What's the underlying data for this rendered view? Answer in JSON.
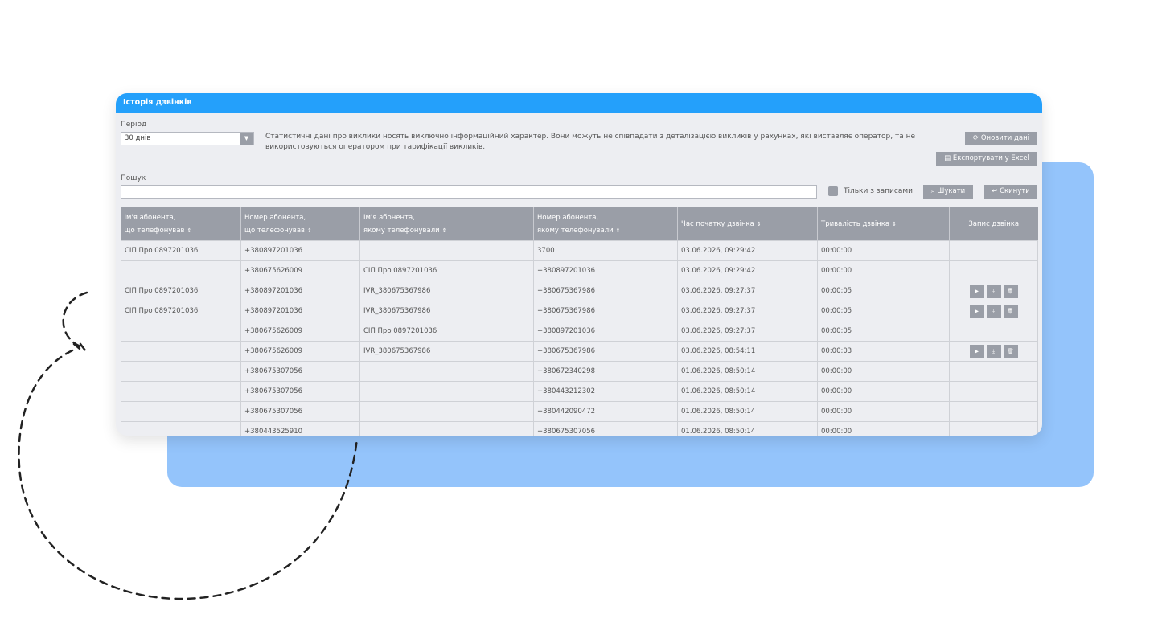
{
  "panel": {
    "title": "Історія дзвінків",
    "period_label": "Період",
    "period_value": "30 днів",
    "info_text": "Статистичні дані про виклики носять виключно інформаційний характер. Вони можуть не співпадати з деталізацією викликів у рахунках, які виставляє оператор, та не використовуються оператором при тарифікації викликів.",
    "refresh_label": "Оновити дані",
    "export_label": "Експортувати у Excel",
    "search_label": "Пошук",
    "search_value": "",
    "only_records_label": "Тільки з записами",
    "search_button": "Шукати",
    "reset_button": "Скинути"
  },
  "table": {
    "headers": [
      [
        "Ім'я абонента,",
        "що телефонував"
      ],
      [
        "Номер абонента,",
        "що телефонував"
      ],
      [
        "Ім'я абонента,",
        "якому телефонували"
      ],
      [
        "Номер абонента,",
        "якому телефонували"
      ],
      [
        "Час початку дзвінка",
        ""
      ],
      [
        "Тривалість дзвінка",
        ""
      ],
      [
        "Запис дзвінка",
        ""
      ]
    ],
    "rows": [
      [
        "СІП Про 0897201036",
        "+380897201036",
        "",
        "3700",
        "03.06.2026, 09:29:42",
        "00:00:00",
        false
      ],
      [
        "",
        "+380675626009",
        "СІП Про 0897201036",
        "+380897201036",
        "03.06.2026, 09:29:42",
        "00:00:00",
        false
      ],
      [
        "СІП Про 0897201036",
        "+380897201036",
        "IVR_380675367986",
        "+380675367986",
        "03.06.2026, 09:27:37",
        "00:00:05",
        true
      ],
      [
        "СІП Про 0897201036",
        "+380897201036",
        "IVR_380675367986",
        "+380675367986",
        "03.06.2026, 09:27:37",
        "00:00:05",
        true
      ],
      [
        "",
        "+380675626009",
        "СІП Про 0897201036",
        "+380897201036",
        "03.06.2026, 09:27:37",
        "00:00:05",
        false
      ],
      [
        "",
        "+380675626009",
        "IVR_380675367986",
        "+380675367986",
        "03.06.2026, 08:54:11",
        "00:00:03",
        true
      ],
      [
        "",
        "+380675307056",
        "",
        "+380672340298",
        "01.06.2026, 08:50:14",
        "00:00:00",
        false
      ],
      [
        "",
        "+380675307056",
        "",
        "+380443212302",
        "01.06.2026, 08:50:14",
        "00:00:00",
        false
      ],
      [
        "",
        "+380675307056",
        "",
        "+380442090472",
        "01.06.2026, 08:50:14",
        "00:00:00",
        false
      ],
      [
        "",
        "+380443525910",
        "",
        "+380675307056",
        "01.06.2026, 08:50:14",
        "00:00:00",
        false
      ]
    ]
  },
  "icons": {
    "refresh": "refresh-icon",
    "export": "export-icon",
    "search": "search-icon",
    "reset": "reset-icon",
    "play": "play-icon",
    "download": "download-icon",
    "delete": "trash-icon",
    "sort": "sort-icon",
    "dropdown": "chevron-down-icon"
  },
  "colors": {
    "header_blue": "#24a0fb",
    "accent_light_blue": "#94c4fb",
    "grey_button": "#9a9ea7",
    "panel_bg": "#edeef2"
  }
}
